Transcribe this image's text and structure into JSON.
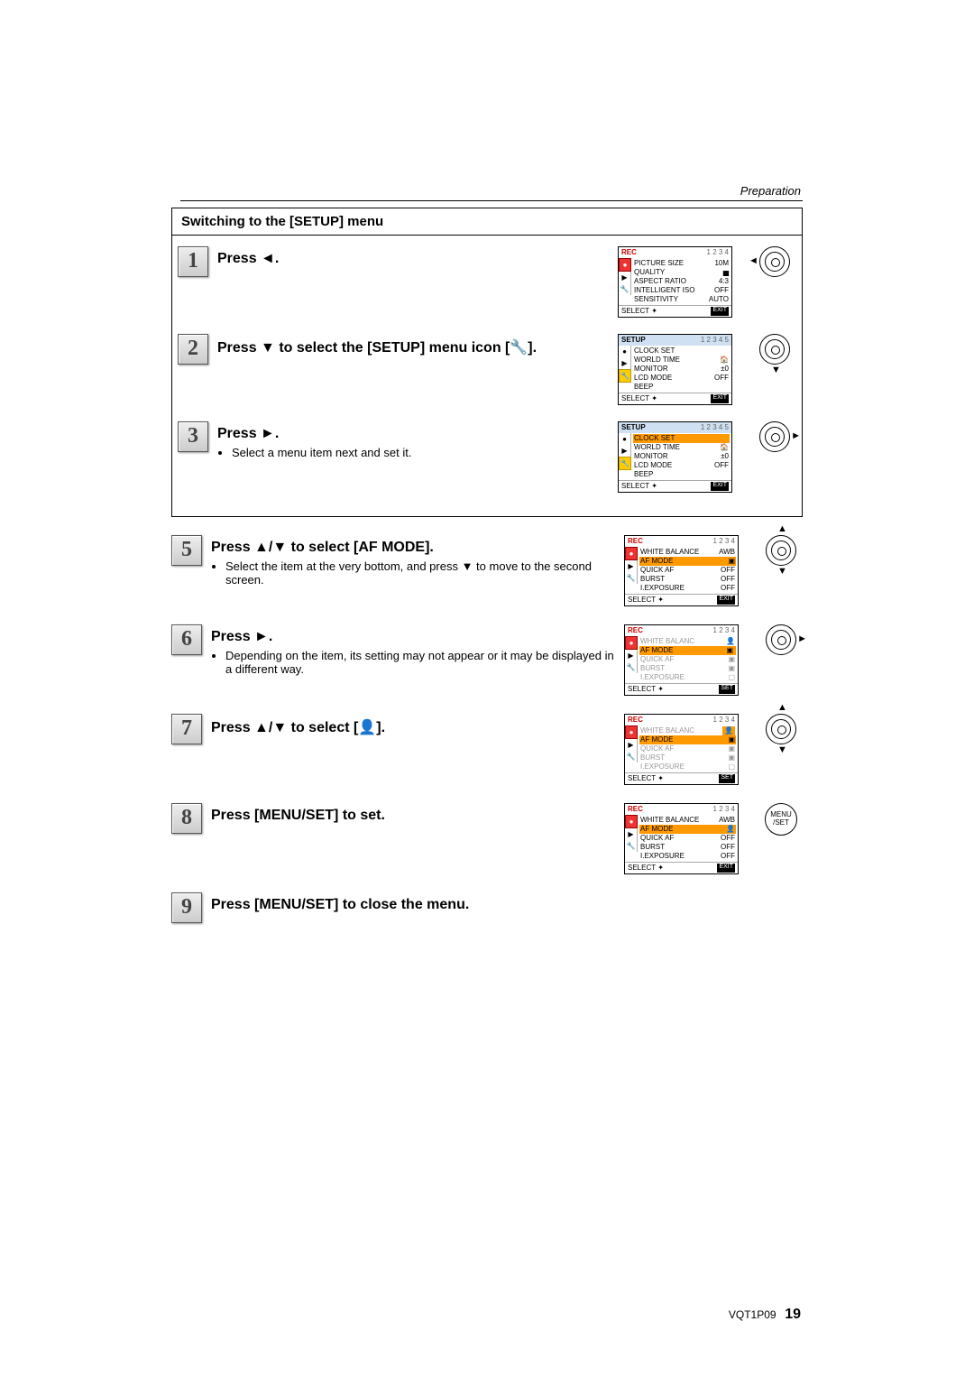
{
  "section_label": "Preparation",
  "setup_box_title": "Switching to the [SETUP] menu",
  "steps_box": [
    {
      "num": "1",
      "title_parts": [
        "Press ",
        "◄",
        "."
      ],
      "bullets": [],
      "dpad": {
        "left": true
      }
    },
    {
      "num": "2",
      "title_parts": [
        "Press ",
        "▼",
        " to select the [SETUP] menu icon [",
        "🔧",
        "]."
      ],
      "bullets": [],
      "dpad": {
        "down": true
      }
    },
    {
      "num": "3",
      "title_parts": [
        "Press ",
        "►",
        "."
      ],
      "bullets": [
        "Select a menu item next and set it."
      ],
      "dpad": {
        "right": true
      }
    }
  ],
  "steps_outer": [
    {
      "num": "5",
      "title_parts": [
        "Press ",
        "▲",
        "/",
        "▼",
        " to select [AF MODE]."
      ],
      "bullets": [
        "Select the item at the very bottom, and press ▼ to move to the second screen."
      ],
      "dpad": {
        "up": true,
        "down": true
      }
    },
    {
      "num": "6",
      "title_parts": [
        "Press ",
        "►",
        "."
      ],
      "bullets": [
        "Depending on the item, its setting may not appear or it may be displayed in a different way."
      ],
      "dpad": {
        "right": true
      }
    },
    {
      "num": "7",
      "title_parts": [
        "Press ",
        "▲",
        "/",
        "▼",
        " to select [",
        "👤",
        "]."
      ],
      "bullets": [],
      "dpad": {
        "up": true,
        "down": true
      }
    },
    {
      "num": "8",
      "title_parts": [
        "Press [MENU/SET] to set."
      ],
      "bullets": [],
      "menu_set": true
    },
    {
      "num": "9",
      "title_parts": [
        "Press [MENU/SET] to close the menu."
      ],
      "bullets": []
    }
  ],
  "menu_set_label": "MENU /SET",
  "lcd_common": {
    "select": "SELECT",
    "exit": "EXIT",
    "set": "SET"
  },
  "lcd_screens": {
    "rec1": {
      "header": "REC",
      "pages": "1 2 3 4",
      "tabs": [
        "●",
        "▶",
        "🔧"
      ],
      "items": [
        {
          "l": "PICTURE SIZE",
          "r": "10M"
        },
        {
          "l": "QUALITY",
          "r": "▅"
        },
        {
          "l": "ASPECT RATIO",
          "r": "4:3"
        },
        {
          "l": "INTELLIGENT ISO",
          "r": "OFF"
        },
        {
          "l": "SENSITIVITY",
          "r": "AUTO"
        }
      ],
      "hl_index": -1,
      "red_tab": 0,
      "foot_r": "EXIT"
    },
    "setup1": {
      "header": "SETUP",
      "pages": "1 2 3 4 5",
      "tabs": [
        "●",
        "▶",
        "🔧"
      ],
      "items": [
        {
          "l": "CLOCK SET",
          "r": ""
        },
        {
          "l": "WORLD TIME",
          "r": "🏠"
        },
        {
          "l": "MONITOR",
          "r": "±0"
        },
        {
          "l": "LCD MODE",
          "r": "OFF"
        },
        {
          "l": "BEEP",
          "r": ""
        }
      ],
      "hl_index": -1,
      "yel_tab": 2,
      "foot_r": "EXIT"
    },
    "setup2": {
      "header": "SETUP",
      "pages": "1 2 3 4 5",
      "tabs": [
        "●",
        "▶",
        "🔧"
      ],
      "items": [
        {
          "l": "CLOCK SET",
          "r": ""
        },
        {
          "l": "WORLD TIME",
          "r": "🏠"
        },
        {
          "l": "MONITOR",
          "r": "±0"
        },
        {
          "l": "LCD MODE",
          "r": "OFF"
        },
        {
          "l": "BEEP",
          "r": ""
        }
      ],
      "hl_index": 0,
      "yel_tab": 2,
      "foot_r": "EXIT"
    },
    "rec_p2a": {
      "header": "REC",
      "pages": "1 2 3 4",
      "tabs": [
        "●",
        "▶",
        "🔧"
      ],
      "items": [
        {
          "l": "WHITE BALANCE",
          "r": "AWB"
        },
        {
          "l": "AF MODE",
          "r": "▣"
        },
        {
          "l": "QUICK AF",
          "r": "OFF"
        },
        {
          "l": "BURST",
          "r": "OFF"
        },
        {
          "l": "I.EXPOSURE",
          "r": "OFF"
        }
      ],
      "hl_index": 1,
      "red_tab": 0,
      "foot_r": "EXIT"
    },
    "rec_p2b": {
      "header": "REC",
      "pages": "1 2 3 4",
      "tabs": [
        "●",
        "▶",
        "🔧"
      ],
      "items": [
        {
          "l": "WHITE BALANC",
          "r": "👤",
          "g": true
        },
        {
          "l": "AF MODE",
          "r": "▣"
        },
        {
          "l": "QUICK AF",
          "r": "▣",
          "g": true
        },
        {
          "l": "BURST",
          "r": "▣",
          "g": true
        },
        {
          "l": "I.EXPOSURE",
          "r": "▢",
          "g": true
        }
      ],
      "hl_index": 1,
      "red_tab": 0,
      "right_hl": 1,
      "foot_r": "SET"
    },
    "rec_p2c": {
      "header": "REC",
      "pages": "1 2 3 4",
      "tabs": [
        "●",
        "▶",
        "🔧"
      ],
      "items": [
        {
          "l": "WHITE BALANC",
          "r": "👤",
          "g": true
        },
        {
          "l": "AF MODE",
          "r": "▣"
        },
        {
          "l": "QUICK AF",
          "r": "▣",
          "g": true
        },
        {
          "l": "BURST",
          "r": "▣",
          "g": true
        },
        {
          "l": "I.EXPOSURE",
          "r": "▢",
          "g": true
        }
      ],
      "hl_index": 1,
      "red_tab": 0,
      "right_hl": 0,
      "foot_r": "SET"
    },
    "rec_p2d": {
      "header": "REC",
      "pages": "1 2 3 4",
      "tabs": [
        "●",
        "▶",
        "🔧"
      ],
      "items": [
        {
          "l": "WHITE BALANCE",
          "r": "AWB"
        },
        {
          "l": "AF MODE",
          "r": "👤"
        },
        {
          "l": "QUICK AF",
          "r": "OFF"
        },
        {
          "l": "BURST",
          "r": "OFF"
        },
        {
          "l": "I.EXPOSURE",
          "r": "OFF"
        }
      ],
      "hl_index": 1,
      "red_tab": 0,
      "foot_r": "EXIT"
    }
  },
  "footer": {
    "doc": "VQT1P09",
    "page": "19"
  }
}
